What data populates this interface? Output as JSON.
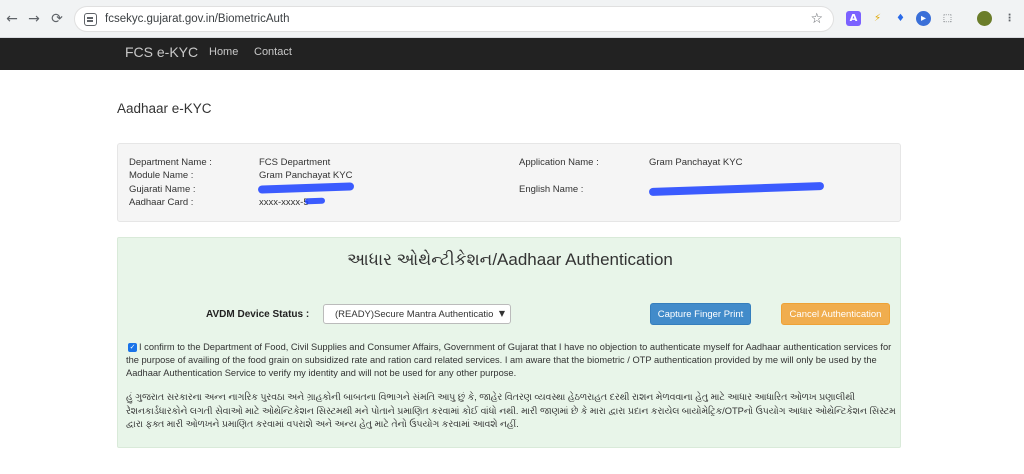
{
  "browser": {
    "url": "fcsekyc.gujarat.gov.in/BiometricAuth",
    "back_icon": "←",
    "forward_icon": "→",
    "reload_icon": "⟳",
    "star_icon": "☆"
  },
  "navbar": {
    "brand": "FCS e-KYC",
    "links": [
      "Home",
      "Contact"
    ]
  },
  "page": {
    "title": "Aadhaar e-KYC"
  },
  "info": {
    "department_label": "Department Name :",
    "department_value": "FCS Department",
    "module_label": "Module Name :",
    "module_value": "Gram Panchayat KYC",
    "gujarati_label": "Gujarati Name :",
    "aadhaar_label": "Aadhaar Card :",
    "aadhaar_value": "xxxx-xxxx-5",
    "application_label": "Application Name :",
    "application_value": "Gram Panchayat KYC",
    "english_label": "English Name :"
  },
  "auth": {
    "title": "આધાર ઓથેન્ટીકેશન/Aadhaar Authentication",
    "device_label": "AVDM Device Status :",
    "device_status": "(READY)Secure Mantra Authenticatio",
    "capture_button": "Capture Finger Print",
    "cancel_button": "Cancel Authentication",
    "consent_checked": true,
    "consent_text": "I confirm to the Department of Food, Civil Supplies and Consumer Affairs, Government of Gujarat that I have no objection to authenticate myself for Aadhaar authentication services for the purpose of availing of the food grain on subsidized rate and ration card related services. I am aware that the biometric / OTP authentication provided by me will only be used by the Aadhaar Authentication Service to verify my identity and will not be used for any other purpose.",
    "gujarati_text": "હું ગુજરાત સરકારના અન્ન નાગરિક પુરવઠા અને ગ્રાહકોની બાબતના વિભાગને સંમતિ આપુ છું કે, જાહેર વિતરણ વ્યવસ્થા હેઠળરાહત દરથી રાશન મેળવવાના હેતુ માટે આધાર આધારિત ઓળખ પ્રણાલીથી રેશનકાર્ડધારકોને લગતી સેવાઓ માટે ઓથેન્ટિકેશન સિસ્ટમથી મને પોતાને પ્રમાણિત કરવામાં કોઈ વાંધો નથી. મારી જાણમાં છે કે મારા દ્વારા પ્રદાન કરાયેલ બાયોમેટ્રિક/OTPનો ઉપયોગ આધાર ઓથેન્ટિકેશન સિસ્ટમ દ્વારા ફક્ત મારી ઓળખને પ્રમાણિત કરવામાં વપરાશે અને અન્ય હેતુ માટે તેનો ઉપયોગ કરવામાં આવશે નહીં."
  },
  "colors": {
    "navbar": "#222222",
    "capture": "#428bca",
    "cancel": "#f0ad4e",
    "auth_bg": "#e8f5e9",
    "redaction": "#1a3fff"
  }
}
